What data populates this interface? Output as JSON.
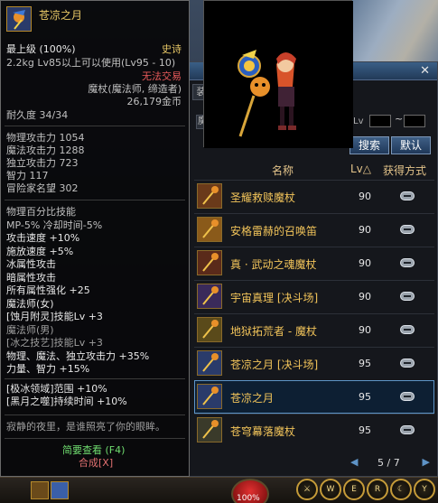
{
  "tooltip": {
    "name": "苍凉之月",
    "grade": "最上级 (100%)",
    "rarity": "史诗",
    "weight_req": "2.2kg  Lv85以上可以使用(Lv95 - 10)",
    "trade": "无法交易",
    "type": "魔杖(魔法师, 缔造者)",
    "price": "26,179金币",
    "durability": "耐久度 34/34",
    "stats": [
      "物理攻击力 1054",
      "魔法攻击力 1288",
      "独立攻击力 723",
      "智力 117",
      "冒险家名望 302"
    ],
    "bonus": [
      "物理百分比技能",
      " MP-5% 冷却时间-5%",
      "攻击速度 +10%",
      "施放速度 +5%",
      "冰属性攻击",
      "暗属性攻击",
      "所有属性强化 +25",
      "魔法师(女)",
      "[蚀月附灵]技能Lv +3",
      "魔法师(男)",
      "[冰之技艺]技能Lv +3",
      "物理、魔法、独立攻击力 +35%",
      "力量、智力 +15%"
    ],
    "extra": [
      "[极冰领域]范围 +10%",
      "[黑月之噬]持续时间 +10%"
    ],
    "flavor": "寂静的夜里，是谁照亮了你的眼眸。",
    "brief_link": "简要查看 (F4)",
    "compose_link": "合成[X]"
  },
  "browser": {
    "close": "✕",
    "tab_stub": "装",
    "filter_stub": "魔",
    "lv_label": "Lv",
    "lv_dash": "~",
    "search_label": "搜索",
    "default_label": "默认",
    "headers": {
      "name": "名称",
      "lv": "Lv△",
      "method": "获得方式"
    },
    "items": [
      {
        "name": "圣耀救赎魔杖",
        "lv": "90",
        "icon": "gold-staff-icon"
      },
      {
        "name": "安格雷赫的召唤笛",
        "lv": "90",
        "icon": "golden-flute-icon"
      },
      {
        "name": "真 · 武动之魂魔杖",
        "lv": "90",
        "icon": "ornate-staff-icon"
      },
      {
        "name": "宇宙真理 [决斗场]",
        "lv": "90",
        "icon": "red-orb-staff-icon"
      },
      {
        "name": "地狱拓荒者 - 魔杖",
        "lv": "90",
        "icon": "dark-staff-icon"
      },
      {
        "name": "苍凉之月 [决斗场]",
        "lv": "95",
        "icon": "moon-staff-icon"
      },
      {
        "name": "苍凉之月",
        "lv": "95",
        "icon": "moon-staff-icon",
        "selected": true
      },
      {
        "name": "苍穹幕落魔杖",
        "lv": "95",
        "icon": "sky-staff-icon"
      }
    ],
    "page": "5 / 7",
    "prev": "◀",
    "next": "▶"
  },
  "bottom": {
    "hp": "100%",
    "skills": [
      "⚔",
      "W",
      "E",
      "R",
      "☾",
      "Y"
    ]
  },
  "colors": {
    "gold": "#e8c866",
    "red": "#e85a5a",
    "green": "#6fdc6f",
    "accent": "#5e95c8"
  }
}
